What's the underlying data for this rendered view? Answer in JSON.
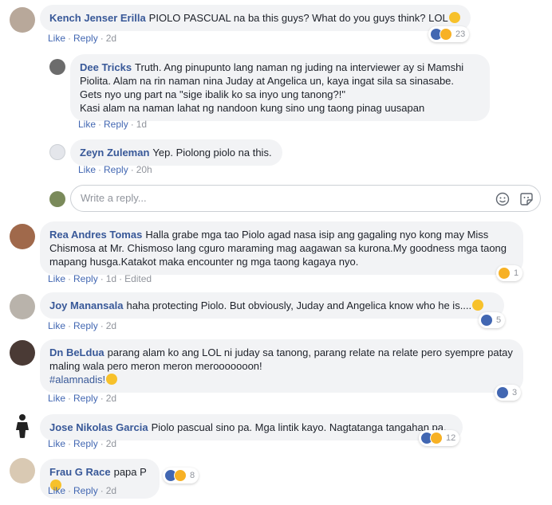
{
  "comments": [
    {
      "author": "Kench Jenser Erilla",
      "text": "PIOLO PASCUAL na ba this guys? What do you guys think? LOL",
      "like": "Like",
      "reply": "Reply",
      "time": "2d",
      "reaction_count": "23"
    },
    {
      "author": "Dee Tricks",
      "text": "Truth. Ang pinupunto lang naman ng juding na interviewer ay si Mamshi Piolita. Alam na rin naman nina Juday at Angelica un, kaya ingat sila sa sinasabe.\nGets nyo ung part na \"sige ibalik ko sa inyo ung tanong?!\"\nKasi alam na naman lahat ng nandoon kung sino ung taong pinag uusapan",
      "like": "Like",
      "reply": "Reply",
      "time": "1d"
    },
    {
      "author": "Zeyn Zuleman",
      "text": "Yep. Piolong piolo na this.",
      "like": "Like",
      "reply": "Reply",
      "time": "20h"
    },
    {
      "author": "Rea Andres Tomas",
      "text": "Halla grabe mga tao Piolo agad nasa isip ang gagaling nyo kong may Miss Chismosa at Mr. Chismoso lang cguro maraming mag aagawan sa kurona.My goodness mga taong mapang husga.Katakot maka encounter ng mga taong kagaya nyo.",
      "like": "Like",
      "reply": "Reply",
      "time": "1d",
      "edited": "Edited",
      "reaction_count": "1"
    },
    {
      "author": "Joy Manansala",
      "text": "haha protecting Piolo. But obviously, Juday and Angelica know who he is....",
      "like": "Like",
      "reply": "Reply",
      "time": "2d",
      "reaction_count": "5"
    },
    {
      "author": "Dn BeLdua",
      "text": "parang alam ko ang LOL ni juday sa tanong, parang relate na relate pero syempre patay maling wala pero meron meron merooooooon!",
      "hashtag": "#alamnadis!",
      "like": "Like",
      "reply": "Reply",
      "time": "2d",
      "reaction_count": "3"
    },
    {
      "author": "Jose Nikolas Garcia",
      "text": "Piolo pascual sino pa. Mga lintik kayo. Nagtatanga tangahan pa.",
      "like": "Like",
      "reply": "Reply",
      "time": "2d",
      "reaction_count": "12"
    },
    {
      "author": "Frau G Race",
      "text": "papa P",
      "like": "Like",
      "reply": "Reply",
      "time": "2d",
      "reaction_count": "8"
    }
  ],
  "reply_box": {
    "placeholder": "Write a reply..."
  },
  "icons": {
    "like": "like-reaction-icon",
    "haha": "haha-reaction-icon",
    "emoji": "emoji-icon",
    "sticker": "sticker-icon"
  },
  "colors": {
    "link": "#385898",
    "action": "#4267b2",
    "muted": "#90949c",
    "bubble": "#f2f3f5"
  }
}
